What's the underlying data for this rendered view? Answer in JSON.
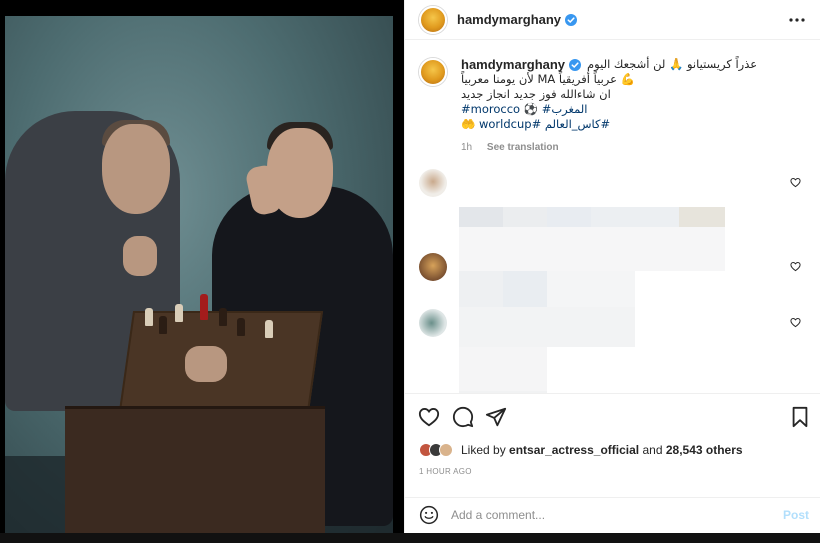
{
  "post": {
    "username": "hamdymarghany",
    "verified": true,
    "caption": {
      "line1": "عذراً كريستيانو 🙏 لن أشجعك اليوم",
      "line2": "💪 عربياً أفريقياً MA لأن يومنا معربياً",
      "line3": "ان شاءالله فوز جديد انجاز جديد",
      "line4": "#morocco ⚽ #المغرب",
      "line5": "#كاس_العالم #worldcup 🤲",
      "age": "1h",
      "see_translation": "See translation"
    },
    "likes": {
      "prefix": "Liked by",
      "user": "entsar_actress_official",
      "and": "and",
      "count": "28,543 others"
    },
    "timestamp": "1 HOUR AGO",
    "add_comment_placeholder": "Add a comment...",
    "post_label": "Post"
  },
  "icons": {
    "more": "more-options-icon",
    "like": "heart-icon",
    "comment": "comment-icon",
    "share": "share-icon",
    "save": "bookmark-icon",
    "emoji": "emoji-icon",
    "verified": "verified-badge-icon"
  },
  "colors": {
    "verified": "#3897f0",
    "link": "#00376b",
    "post_button": "#b2dffc"
  }
}
